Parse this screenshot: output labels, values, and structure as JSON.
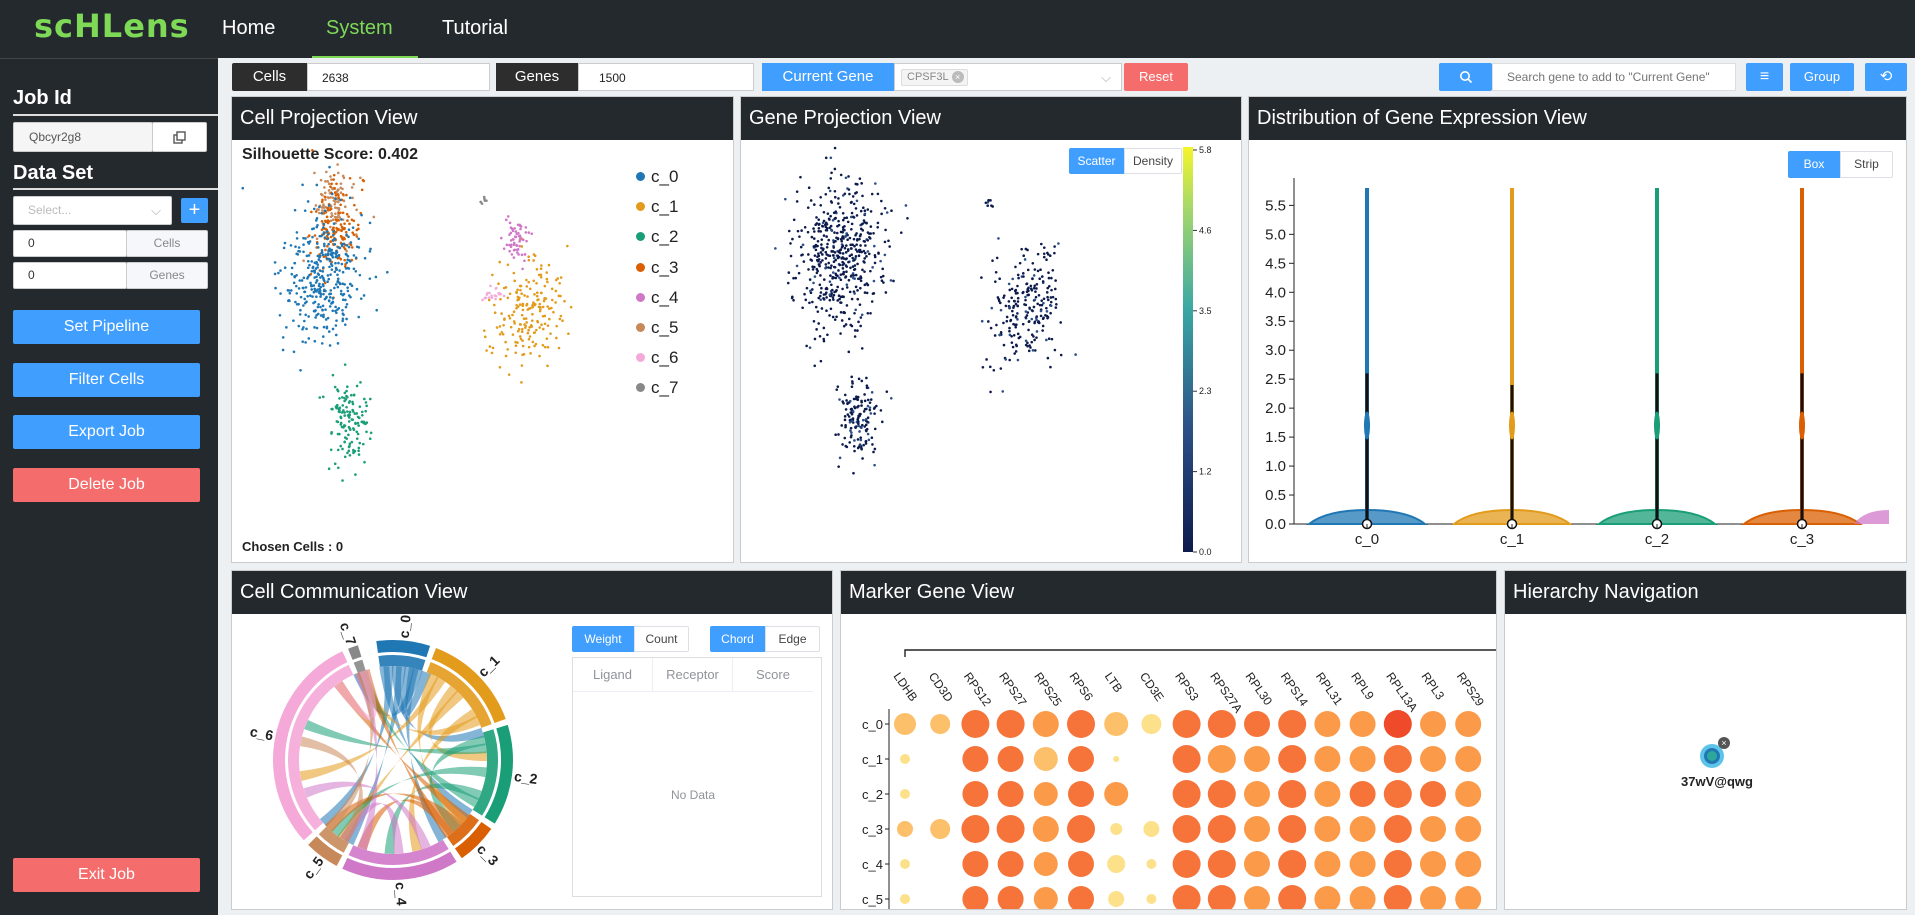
{
  "nav": {
    "logo": "scHLens",
    "home": "Home",
    "system": "System",
    "tutorial": "Tutorial"
  },
  "sidebar": {
    "job_id_title": "Job Id",
    "job_id_value": "Qbcyr2g8",
    "dataset_title": "Data Set",
    "dataset_placeholder": "Select...",
    "cells_value": "0",
    "cells_label": "Cells",
    "genes_value": "0",
    "genes_label": "Genes",
    "set_pipeline": "Set Pipeline",
    "filter_cells": "Filter Cells",
    "export_job": "Export Job",
    "delete_job": "Delete Job",
    "exit_job": "Exit Job"
  },
  "toolbar": {
    "cells_label": "Cells",
    "cells_value": "2638",
    "genes_label": "Genes",
    "genes_value": "1500",
    "current_gene_label": "Current Gene",
    "current_gene_tag": "CPSF3L",
    "reset": "Reset",
    "search_placeholder": "Search gene to add to \"Current Gene\"",
    "group": "Group"
  },
  "cell_projection": {
    "title": "Cell Projection View",
    "silhouette": "Silhouette Score: 0.402",
    "chosen": "Chosen Cells : 0",
    "legend": [
      {
        "label": "c_0",
        "color": "#1f77b4"
      },
      {
        "label": "c_1",
        "color": "#e39b1c"
      },
      {
        "label": "c_2",
        "color": "#1a9e77"
      },
      {
        "label": "c_3",
        "color": "#d95f02"
      },
      {
        "label": "c_4",
        "color": "#d078c8"
      },
      {
        "label": "c_5",
        "color": "#c8895a"
      },
      {
        "label": "c_6",
        "color": "#f4a9d8"
      },
      {
        "label": "c_7",
        "color": "#888888"
      }
    ]
  },
  "gene_projection": {
    "title": "Gene Projection View",
    "scatter": "Scatter",
    "density": "Density",
    "colorbar_ticks": [
      "5.8",
      "4.6",
      "3.5",
      "2.3",
      "1.2",
      "0.0"
    ]
  },
  "distribution": {
    "title": "Distribution of Gene Expression View",
    "box": "Box",
    "strip": "Strip"
  },
  "chart_data": {
    "type": "violin",
    "categories": [
      "c_0",
      "c_1",
      "c_2",
      "c_3"
    ],
    "colors": [
      "#1f77b4",
      "#e39b1c",
      "#1a9e77",
      "#d95f02"
    ],
    "max": [
      5.8,
      5.8,
      5.8,
      5.8
    ],
    "upper_whisker": [
      2.6,
      2.4,
      2.6,
      2.6
    ],
    "median": [
      0,
      0,
      0,
      0
    ],
    "yticks": [
      "0.0",
      "0.5",
      "1.0",
      "1.5",
      "2.0",
      "2.5",
      "3.0",
      "3.5",
      "4.0",
      "4.5",
      "5.0",
      "5.5"
    ],
    "ylim": [
      0,
      5.8
    ]
  },
  "communication": {
    "title": "Cell Communication View",
    "weight": "Weight",
    "count": "Count",
    "chord": "Chord",
    "edge": "Edge",
    "columns": [
      "Ligand",
      "Receptor",
      "Score"
    ],
    "empty": "No Data",
    "arcs": [
      "c_0",
      "c_1",
      "c_2",
      "c_3",
      "c_4",
      "c_5",
      "c_6",
      "c_7"
    ]
  },
  "marker": {
    "title": "Marker Gene View",
    "genes": [
      "LDHB",
      "CD3D",
      "RPS12",
      "RPS27",
      "RPS25",
      "RPS6",
      "LTB",
      "CD3E",
      "RPS3",
      "RPS27A",
      "RPL30",
      "RPS14",
      "RPL31",
      "RPL9",
      "RPL13A",
      "RPL3",
      "RPS29"
    ],
    "rows": [
      "c_0",
      "c_1",
      "c_2",
      "c_3",
      "c_4",
      "c_5"
    ]
  },
  "hierarchy": {
    "title": "Hierarchy Navigation",
    "node_label": "37wV@qwg"
  }
}
